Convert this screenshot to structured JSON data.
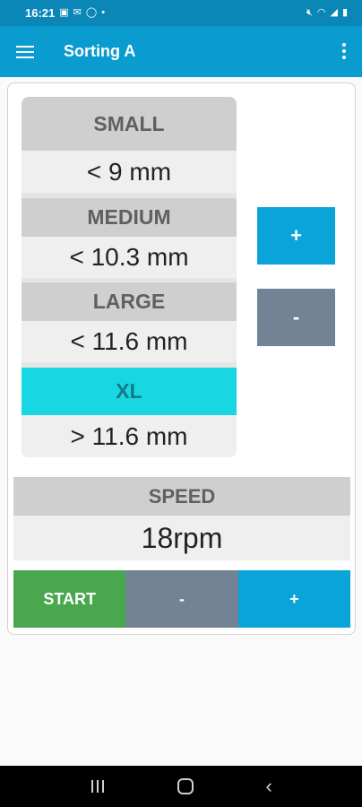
{
  "status_bar": {
    "time": "16:21",
    "left_icons": [
      "image-icon",
      "gmail-icon",
      "whatsapp-icon",
      "dot-icon"
    ],
    "right_icons": [
      "mute-icon",
      "wifi-icon",
      "signal-icon",
      "battery-icon"
    ]
  },
  "app_bar": {
    "title": "Sorting A"
  },
  "sizes": [
    {
      "name": "SMALL",
      "value": "< 9 mm",
      "active": false
    },
    {
      "name": "MEDIUM",
      "value": "< 10.3 mm",
      "active": false
    },
    {
      "name": "LARGE",
      "value": "< 11.6 mm",
      "active": false
    },
    {
      "name": "XL",
      "value": "> 11.6 mm",
      "active": true
    }
  ],
  "size_controls": {
    "plus_label": "+",
    "minus_label": "-"
  },
  "speed": {
    "label": "SPEED",
    "value": "18rpm"
  },
  "bottom_controls": {
    "start_label": "START",
    "minus_label": "-",
    "plus_label": "+"
  },
  "colors": {
    "app_bar": "#0a9bcf",
    "status_bar": "#0a87b6",
    "accent_plus": "#0ba4d8",
    "accent_minus": "#718394",
    "start": "#49a74f",
    "active_size": "#19d6e3"
  }
}
